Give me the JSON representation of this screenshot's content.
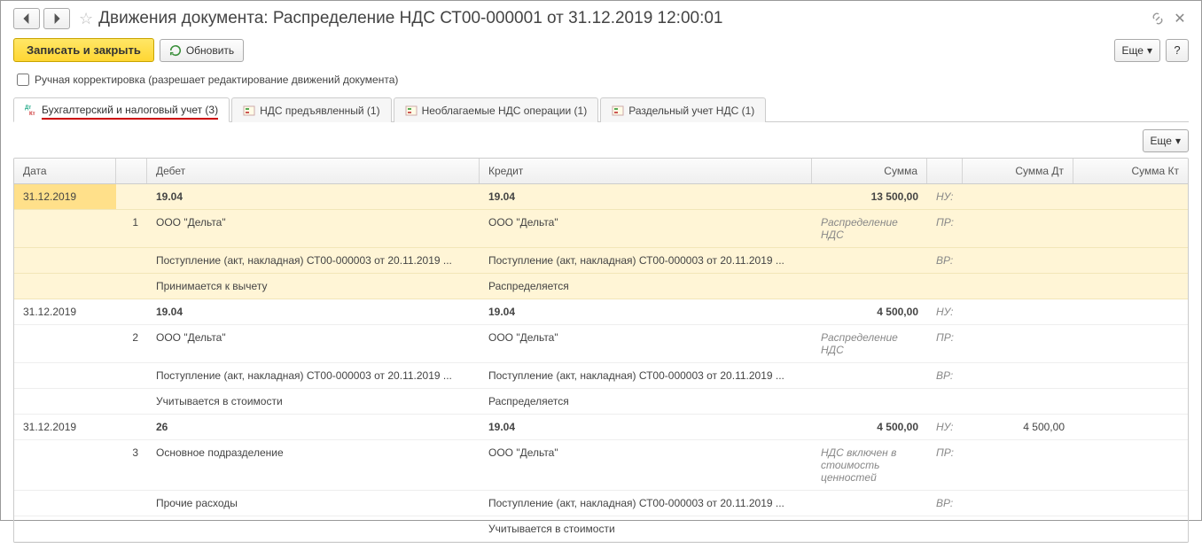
{
  "header": {
    "title": "Движения документа: Распределение НДС СТ00-000001 от 31.12.2019 12:00:01"
  },
  "toolbar": {
    "save_close": "Записать и закрыть",
    "refresh": "Обновить",
    "more": "Еще",
    "help": "?"
  },
  "manual_edit": {
    "label": "Ручная корректировка (разрешает редактирование движений документа)"
  },
  "tabs": [
    {
      "label": "Бухгалтерский и налоговый учет (3)",
      "active": true,
      "icon": "dtkt"
    },
    {
      "label": "НДС предъявленный (1)",
      "active": false,
      "icon": "reg"
    },
    {
      "label": "Необлагаемые НДС операции (1)",
      "active": false,
      "icon": "reg"
    },
    {
      "label": "Раздельный учет НДС (1)",
      "active": false,
      "icon": "reg"
    }
  ],
  "pane": {
    "more": "Еще"
  },
  "grid": {
    "cols": {
      "date": "Дата",
      "debit": "Дебет",
      "credit": "Кредит",
      "sum": "Сумма",
      "sumdt": "Сумма Дт",
      "sumkt": "Сумма Кт"
    },
    "tags": {
      "nu": "НУ:",
      "pr": "ПР:",
      "vr": "ВР:"
    },
    "entries": [
      {
        "selected": true,
        "date": "31.12.2019",
        "n": "1",
        "debit_acct": "19.04",
        "credit_acct": "19.04",
        "sum": "13 500,00",
        "note_sum": "Распределение НДС",
        "debit_r1": "ООО \"Дельта\"",
        "credit_r1": "ООО \"Дельта\"",
        "debit_r2": "Поступление (акт, накладная) СТ00-000003 от 20.11.2019 ...",
        "credit_r2": "Поступление (акт, накладная) СТ00-000003 от 20.11.2019 ...",
        "debit_r3": "Принимается к вычету",
        "credit_r3": "Распределяется",
        "sumdt": ""
      },
      {
        "selected": false,
        "date": "31.12.2019",
        "n": "2",
        "debit_acct": "19.04",
        "credit_acct": "19.04",
        "sum": "4 500,00",
        "note_sum": "Распределение НДС",
        "debit_r1": "ООО \"Дельта\"",
        "credit_r1": "ООО \"Дельта\"",
        "debit_r2": "Поступление (акт, накладная) СТ00-000003 от 20.11.2019 ...",
        "credit_r2": "Поступление (акт, накладная) СТ00-000003 от 20.11.2019 ...",
        "debit_r3": "Учитывается в стоимости",
        "credit_r3": "Распределяется",
        "sumdt": ""
      },
      {
        "selected": false,
        "date": "31.12.2019",
        "n": "3",
        "debit_acct": "26",
        "credit_acct": "19.04",
        "sum": "4 500,00",
        "note_sum": "НДС включен в стоимость ценностей",
        "debit_r1": "Основное подразделение",
        "credit_r1": "ООО \"Дельта\"",
        "debit_r2": "Прочие расходы",
        "credit_r2": "Поступление (акт, накладная) СТ00-000003 от 20.11.2019 ...",
        "debit_r3": "",
        "credit_r3": "Учитывается в стоимости",
        "sumdt": "4 500,00"
      }
    ]
  }
}
